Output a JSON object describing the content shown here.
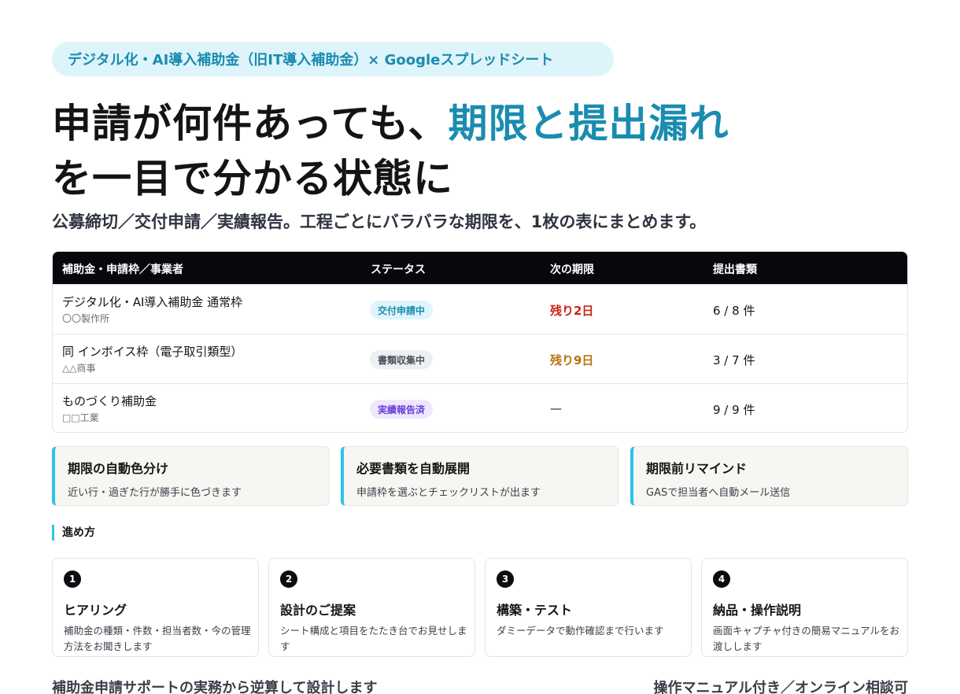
{
  "tagline": "デジタル化・AI導入補助金（旧IT導入補助金）× Googleスプレッドシート",
  "headline": {
    "part1": "申請が何件あっても、",
    "accent": "期限と提出漏れ",
    "part2": "を一目で分かる状態に"
  },
  "subline": "公募締切／交付申請／実績報告。工程ごとにバラバラな期限を、1枚の表にまとめます。",
  "table": {
    "headers": [
      "補助金・申請枠／事業者",
      "ステータス",
      "次の期限",
      "提出書類"
    ],
    "rows": [
      {
        "name": "デジタル化・AI導入補助金 通常枠",
        "company": "〇〇製作所",
        "status": "交付申請中",
        "deadline": "残り2日",
        "docs": "6 / 8 件"
      },
      {
        "name": "同 インボイス枠（電子取引類型）",
        "company": "△△商事",
        "status": "書類収集中",
        "deadline": "残り9日",
        "docs": "3 / 7 件"
      },
      {
        "name": "ものづくり補助金",
        "company": "□□工業",
        "status": "実績報告済",
        "deadline": "—",
        "docs": "9 / 9 件"
      }
    ]
  },
  "features": [
    {
      "title": "期限の自動色分け",
      "desc": "近い行・過ぎた行が勝手に色づきます"
    },
    {
      "title": "必要書類を自動展開",
      "desc": "申請枠を選ぶとチェックリストが出ます"
    },
    {
      "title": "期限前リマインド",
      "desc": "GASで担当者へ自動メール送信"
    }
  ],
  "section_label": "進め方",
  "steps": [
    {
      "num": "1",
      "title": "ヒアリング",
      "desc": "補助金の種類・件数・担当者数・今の管理方法をお聞きします"
    },
    {
      "num": "2",
      "title": "設計のご提案",
      "desc": "シート構成と項目をたたき台でお見せします"
    },
    {
      "num": "3",
      "title": "構築・テスト",
      "desc": "ダミーデータで動作確認まで行います"
    },
    {
      "num": "4",
      "title": "納品・操作説明",
      "desc": "画面キャプチャ付きの簡易マニュアルをお渡しします"
    }
  ],
  "footer": {
    "left": "補助金申請サポートの実務から逆算して設計します",
    "right": "操作マニュアル付き／オンライン相談可"
  },
  "colors": {
    "accent": "#1a8caf",
    "accent_bar": "#2cc4e8",
    "status_blue_bg": "#dff5fb",
    "status_blue_text": "#1a8caf",
    "status_gray_bg": "#eeeff2",
    "status_gray_text": "#4a4f59",
    "status_purple_bg": "#efe8fd",
    "status_purple_text": "#6a3fd6",
    "deadline_red": "#c8231b",
    "deadline_amber": "#b8730f"
  }
}
